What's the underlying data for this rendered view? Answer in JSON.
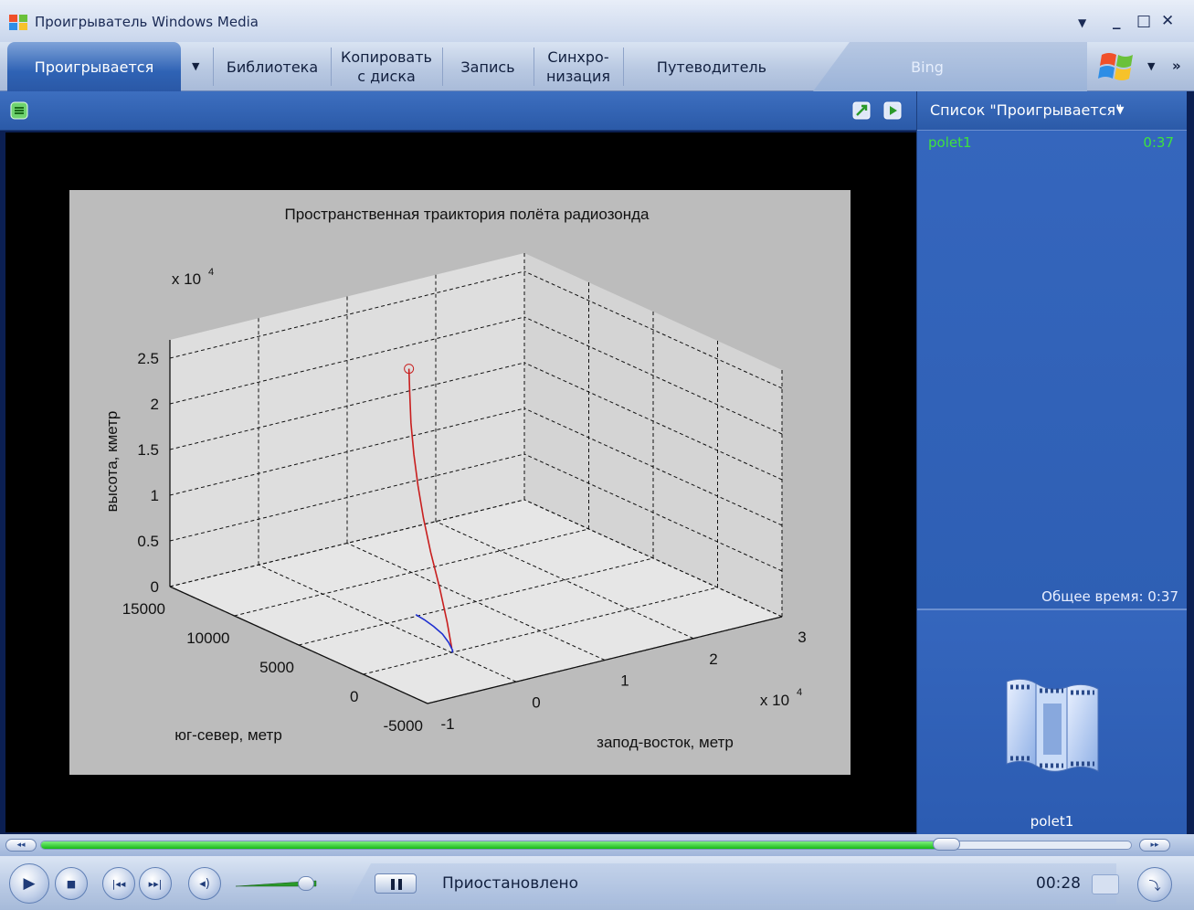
{
  "window": {
    "title": "Проигрыватель Windows Media"
  },
  "tabs": [
    {
      "label": "Проигрывается",
      "active": true
    },
    {
      "label": "Библиотека",
      "active": false
    },
    {
      "label": "Копировать\nс диска",
      "line1": "Копировать",
      "line2": "с диска",
      "active": false
    },
    {
      "label": "Запись",
      "active": false
    },
    {
      "label": "Синхро-\nнизация",
      "line1": "Синхро-",
      "line2": "низация",
      "active": false
    },
    {
      "label": "Путеводитель",
      "active": false
    },
    {
      "label": "Bing",
      "active": false
    }
  ],
  "icons": {
    "app": "windows-media-icon",
    "minimize": "minimize-icon",
    "maximize": "maximize-icon",
    "close": "close-icon",
    "mini_mode": "mini-mode-icon",
    "windows_logo": "windows-logo-icon",
    "menu_toggle": "layout-options-icon",
    "nav": "navigation-icon"
  },
  "colors": {
    "accent": "#2d5cb0",
    "playlist_text": "#3ee23e",
    "seek_fill": "#16b816",
    "trajectory_red": "#c81e1e",
    "trajectory_blue": "#1e2fd0"
  },
  "playlist": {
    "title": "Список \"Проигрывается\"",
    "items": [
      {
        "name": "polet1",
        "duration": "0:37"
      }
    ],
    "total": "Общее время: 0:37",
    "now_playing": "polet1"
  },
  "player": {
    "status": "Приостановлено",
    "time": "00:28",
    "progress": 0.83,
    "volume": 0.85
  },
  "chart_data": {
    "type": "line",
    "title": "Пространственная траиктория полёта радиозонда",
    "xlabel": "запод-восток, метр",
    "ylabel": "юг-север, метр",
    "zlabel": "высота, кметр",
    "x_ticks": [
      "-1",
      "0",
      "1",
      "2",
      "3"
    ],
    "x_multiplier": "x 10^4",
    "y_ticks": [
      "-5000",
      "0",
      "5000",
      "10000",
      "15000"
    ],
    "z_ticks": [
      "0",
      "0.5",
      "1",
      "1.5",
      "2",
      "2.5"
    ],
    "z_multiplier": "x 10^4",
    "grid": true,
    "series": [
      {
        "color": "#c81e1e",
        "points": [
          [
            0,
            0,
            500
          ],
          [
            200,
            500,
            3000
          ],
          [
            800,
            1500,
            6000
          ],
          [
            1400,
            2600,
            9000
          ],
          [
            1900,
            3500,
            12000
          ],
          [
            2300,
            4200,
            15000
          ],
          [
            2700,
            4800,
            18000
          ],
          [
            3100,
            5300,
            21000
          ],
          [
            3400,
            5600,
            24000
          ],
          [
            3600,
            5800,
            26500
          ]
        ]
      },
      {
        "color": "#1e2fd0",
        "points": [
          [
            0,
            0,
            0
          ],
          [
            400,
            200,
            0
          ],
          [
            1400,
            1200,
            0
          ],
          [
            2300,
            2300,
            0
          ],
          [
            2900,
            3400,
            0
          ],
          [
            3300,
            4400,
            0
          ],
          [
            3500,
            5200,
            0
          ]
        ]
      }
    ]
  }
}
